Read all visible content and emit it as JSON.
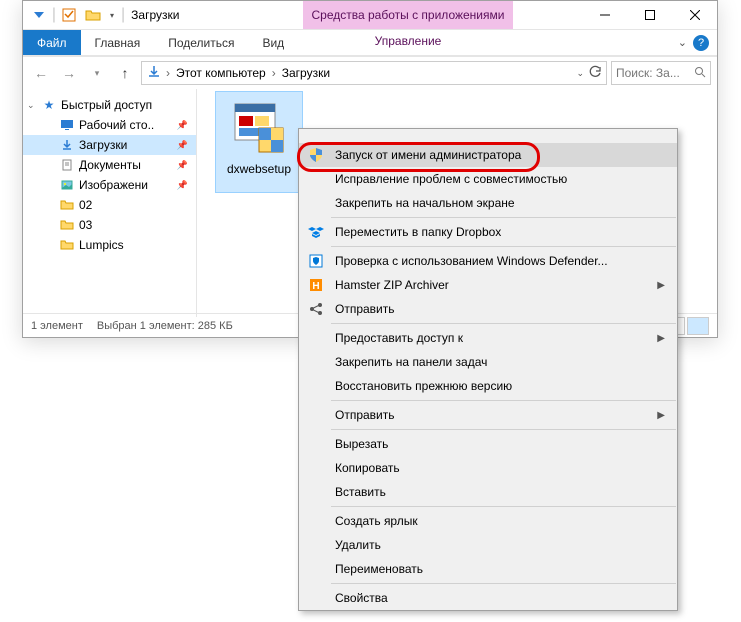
{
  "titlebar": {
    "title": "Загрузки",
    "context_title": "Средства работы с приложениями"
  },
  "ribbon": {
    "file": "Файл",
    "home": "Главная",
    "share": "Поделиться",
    "view": "Вид",
    "manage": "Управление"
  },
  "breadcrumb": {
    "root": "Этот компьютер",
    "current": "Загрузки"
  },
  "search": {
    "placeholder": "Поиск: За..."
  },
  "sidebar": {
    "quick": "Быстрый доступ",
    "items": [
      {
        "label": "Рабочий сто..",
        "icon": "desktop",
        "pinned": true
      },
      {
        "label": "Загрузки",
        "icon": "downloads",
        "pinned": true,
        "selected": true
      },
      {
        "label": "Документы",
        "icon": "documents",
        "pinned": true
      },
      {
        "label": "Изображени",
        "icon": "pictures",
        "pinned": true
      },
      {
        "label": "02",
        "icon": "folder"
      },
      {
        "label": "03",
        "icon": "folder"
      },
      {
        "label": "Lumpics",
        "icon": "folder"
      }
    ]
  },
  "file": {
    "name": "dxwebsetup"
  },
  "status": {
    "count": "1 элемент",
    "selection": "Выбран 1 элемент: 285 КБ"
  },
  "ctx": {
    "open_partial": "",
    "run_admin": "Запуск от имени администратора",
    "compat": "Исправление проблем с совместимостью",
    "pin_start": "Закрепить на начальном экране",
    "dropbox": "Переместить в папку Dropbox",
    "defender": "Проверка с использованием Windows Defender...",
    "hamster": "Hamster ZIP Archiver",
    "send1": "Отправить",
    "share_access": "Предоставить доступ к",
    "pin_taskbar": "Закрепить на панели задач",
    "restore": "Восстановить прежнюю версию",
    "send2": "Отправить",
    "cut": "Вырезать",
    "copy": "Копировать",
    "paste": "Вставить",
    "shortcut": "Создать ярлык",
    "delete": "Удалить",
    "rename": "Переименовать",
    "properties": "Свойства"
  }
}
